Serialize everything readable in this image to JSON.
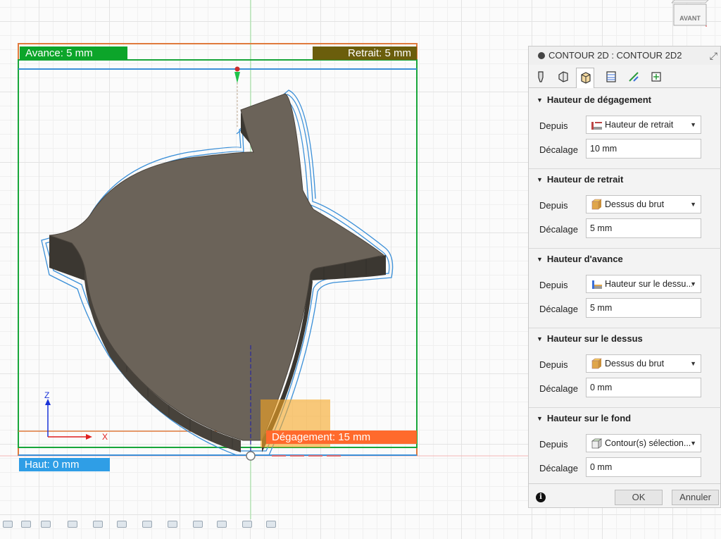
{
  "viewport": {
    "labels": {
      "avance": "Avance: 5 mm",
      "retrait": "Retrait: 5 mm",
      "degagement": "Dégagement: 15 mm",
      "haut": "Haut: 0 mm"
    },
    "axes": {
      "z": "Z",
      "x": "X"
    },
    "viewcube_face": "AVANT"
  },
  "panel": {
    "title": "CONTOUR 2D : CONTOUR 2D2",
    "tabs": [
      "tool-tab-icon",
      "geometry-tab-icon",
      "heights-tab-icon",
      "passes-tab-icon",
      "linking-tab-icon",
      "post-tab-icon"
    ],
    "sections": [
      {
        "title": "Hauteur de dégagement",
        "from_label": "Depuis",
        "from_value": "Hauteur de retrait",
        "from_icon": "retract-height-icon",
        "offset_label": "Décalage",
        "offset_value": "10 mm"
      },
      {
        "title": "Hauteur de retrait",
        "from_label": "Depuis",
        "from_value": "Dessus du brut",
        "from_icon": "stock-top-icon",
        "offset_label": "Décalage",
        "offset_value": "5 mm"
      },
      {
        "title": "Hauteur d'avance",
        "from_label": "Depuis",
        "from_value": "Hauteur sur le dessu...",
        "from_icon": "top-height-icon",
        "offset_label": "Décalage",
        "offset_value": "5 mm"
      },
      {
        "title": "Hauteur sur le dessus",
        "from_label": "Depuis",
        "from_value": "Dessus du brut",
        "from_icon": "stock-top-icon",
        "offset_label": "Décalage",
        "offset_value": "0 mm"
      },
      {
        "title": "Hauteur sur le fond",
        "from_label": "Depuis",
        "from_value": "Contour(s) sélection...",
        "from_icon": "selected-contour-icon",
        "offset_label": "Décalage",
        "offset_value": "0 mm"
      }
    ],
    "ok_label": "OK",
    "cancel_label": "Annuler"
  },
  "colors": {
    "avance": "#0ca52a",
    "retrait": "#6b5e0c",
    "degagement": "#ff6a2c",
    "haut": "#2f9ee6",
    "part": "#6b6359",
    "toolpath": "#3a8fd8"
  }
}
